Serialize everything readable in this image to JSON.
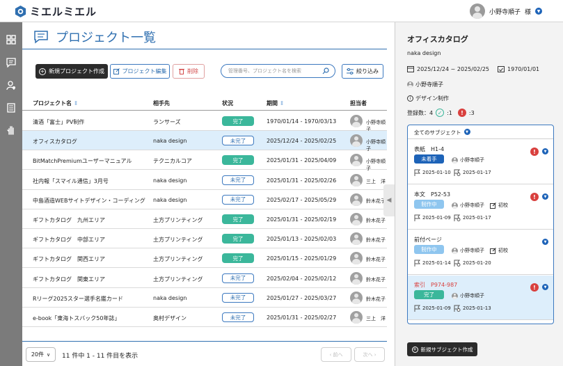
{
  "app": {
    "name": "ミエルミエル"
  },
  "user": {
    "name": "小野寺順子",
    "suffix": "様"
  },
  "page": {
    "title": "プロジェクト一覧"
  },
  "toolbar": {
    "new_project": "新規プロジェクト作成",
    "edit_project": "プロジェクト編集",
    "delete": "削除",
    "search_placeholder": "管理番号、プロジェクト名を検索",
    "filter": "絞り込み"
  },
  "table": {
    "headers": {
      "name": "プロジェクト名",
      "client": "相手先",
      "status": "状況",
      "period": "期間",
      "owner": "担当者"
    },
    "rows": [
      {
        "name": "清酒「富士」PV制作",
        "client": "ランサーズ",
        "status": "完了",
        "period": "1970/01/14 - 1970/03/13",
        "owner": "小野寺順子"
      },
      {
        "name": "オフィスカタログ",
        "client": "naka design",
        "status": "未完了",
        "period": "2025/12/24 - 2025/02/25",
        "owner": "小野寺順子"
      },
      {
        "name": "BitMatchPremiumユーザーマニュアル",
        "client": "テクニカルコア",
        "status": "完了",
        "period": "2025/01/31 - 2025/04/09",
        "owner": "小野寺順子"
      },
      {
        "name": "社内報「スマイル通信」3月号",
        "client": "naka design",
        "status": "未完了",
        "period": "2025/01/31 - 2025/02/26",
        "owner": "三上　洋"
      },
      {
        "name": "中島酒造WEBサイトデザイン・コーディング",
        "client": "naka design",
        "status": "未完了",
        "period": "2025/02/17 - 2025/05/29",
        "owner": "鈴木花子"
      },
      {
        "name": "ギフトカタログ　九州エリア",
        "client": "土方プリンティング",
        "status": "完了",
        "period": "2025/01/31 - 2025/02/19",
        "owner": "鈴木花子"
      },
      {
        "name": "ギフトカタログ　中部エリア",
        "client": "土方プリンティング",
        "status": "完了",
        "period": "2025/01/13 - 2025/02/03",
        "owner": "鈴木花子"
      },
      {
        "name": "ギフトカタログ　関西エリア",
        "client": "土方プリンティング",
        "status": "完了",
        "period": "2025/01/15 - 2025/01/29",
        "owner": "鈴木花子"
      },
      {
        "name": "ギフトカタログ　関東エリア",
        "client": "土方プリンティング",
        "status": "未完了",
        "period": "2025/02/04 - 2025/02/12",
        "owner": "鈴木花子"
      },
      {
        "name": "Rリーグ2025スター選手名鑑カード",
        "client": "naka design",
        "status": "未完了",
        "period": "2025/01/27 - 2025/03/27",
        "owner": "鈴木花子"
      },
      {
        "name": "e-book「東海トスバック50年誌」",
        "client": "奥村デザイン",
        "status": "未完了",
        "period": "2025/01/31 - 2025/02/27",
        "owner": "三上　洋"
      }
    ]
  },
  "pagination": {
    "per_page": "20件",
    "summary": "11 件中 1 - 11 件目を表示",
    "prev": "前へ",
    "next": "次へ"
  },
  "panel": {
    "title": "オフィスカタログ",
    "client": "naka design",
    "period": "2025/12/24 ~ 2025/02/25",
    "due": "1970/01/01",
    "owner": "小野寺順子",
    "description": "デザイン制作",
    "count_label": "登録数：4",
    "ok_count": ":1",
    "alert_count": ":3",
    "subjects_header": "全てのサブジェクト",
    "subjects": [
      {
        "title": "表紙　H1-4",
        "status": "未着手",
        "user": "小野寺順子",
        "extra": "",
        "start": "2025-01-10",
        "end": "2025-01-17"
      },
      {
        "title": "本文　P52-53",
        "status": "制作中",
        "user": "小野寺順子",
        "extra": "初校",
        "start": "2025-01-09",
        "end": "2025-01-17"
      },
      {
        "title": "前付ページ",
        "status": "制作中",
        "user": "小野寺順子",
        "extra": "初校",
        "start": "2025-01-14",
        "end": "2025-01-20"
      },
      {
        "title": "索引　P974-987",
        "status": "完了",
        "user": "小野寺順子",
        "extra": "",
        "start": "2025-01-09",
        "end": "2025-01-13"
      }
    ],
    "new_subject": "新規サブジェクト作成"
  },
  "colors": {
    "accent": "#2f6fb0",
    "done": "#3bb79b",
    "alert": "#d9403e",
    "selected_row": "#ddeefb"
  }
}
